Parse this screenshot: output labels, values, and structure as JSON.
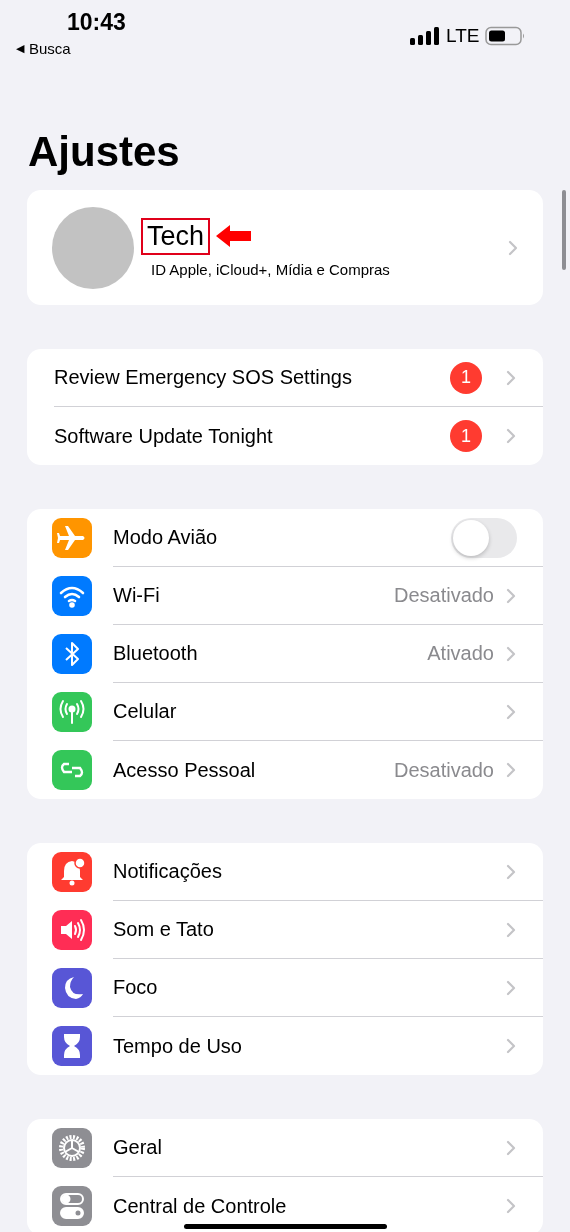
{
  "status_bar": {
    "time": "10:43",
    "back_arrow": "◀",
    "back_label": "Busca",
    "network": "LTE"
  },
  "title": "Ajustes",
  "profile": {
    "name": "Tech",
    "highlighted": true,
    "subtitle": "ID Apple, iCloud+, Mídia e Compras"
  },
  "groups": [
    {
      "rows": [
        {
          "kind": "alert",
          "label": "Review Emergency SOS Settings",
          "badge": "1"
        },
        {
          "kind": "alert",
          "label": "Software Update Tonight",
          "badge": "1"
        }
      ]
    },
    {
      "rows": [
        {
          "kind": "toggle",
          "color": "#ff9500",
          "label": "Modo Avião",
          "on": false
        },
        {
          "kind": "link",
          "color": "#007aff",
          "label": "Wi-Fi",
          "value": "Desativado"
        },
        {
          "kind": "link",
          "color": "#007aff",
          "label": "Bluetooth",
          "value": "Ativado"
        },
        {
          "kind": "link",
          "color": "#34c759",
          "label": "Celular"
        },
        {
          "kind": "link",
          "color": "#34c759",
          "label": "Acesso Pessoal",
          "value": "Desativado"
        }
      ]
    },
    {
      "rows": [
        {
          "kind": "link",
          "color": "#ff3b30",
          "label": "Notificações"
        },
        {
          "kind": "link",
          "color": "#ff2d55",
          "label": "Som e Tato"
        },
        {
          "kind": "link",
          "color": "#5856d6",
          "label": "Foco"
        },
        {
          "kind": "link",
          "color": "#5856d6",
          "label": "Tempo de Uso"
        }
      ]
    },
    {
      "rows": [
        {
          "kind": "link",
          "color": "#8e8e93",
          "label": "Geral"
        },
        {
          "kind": "link",
          "color": "#8e8e93",
          "label": "Central de Controle"
        }
      ]
    }
  ]
}
